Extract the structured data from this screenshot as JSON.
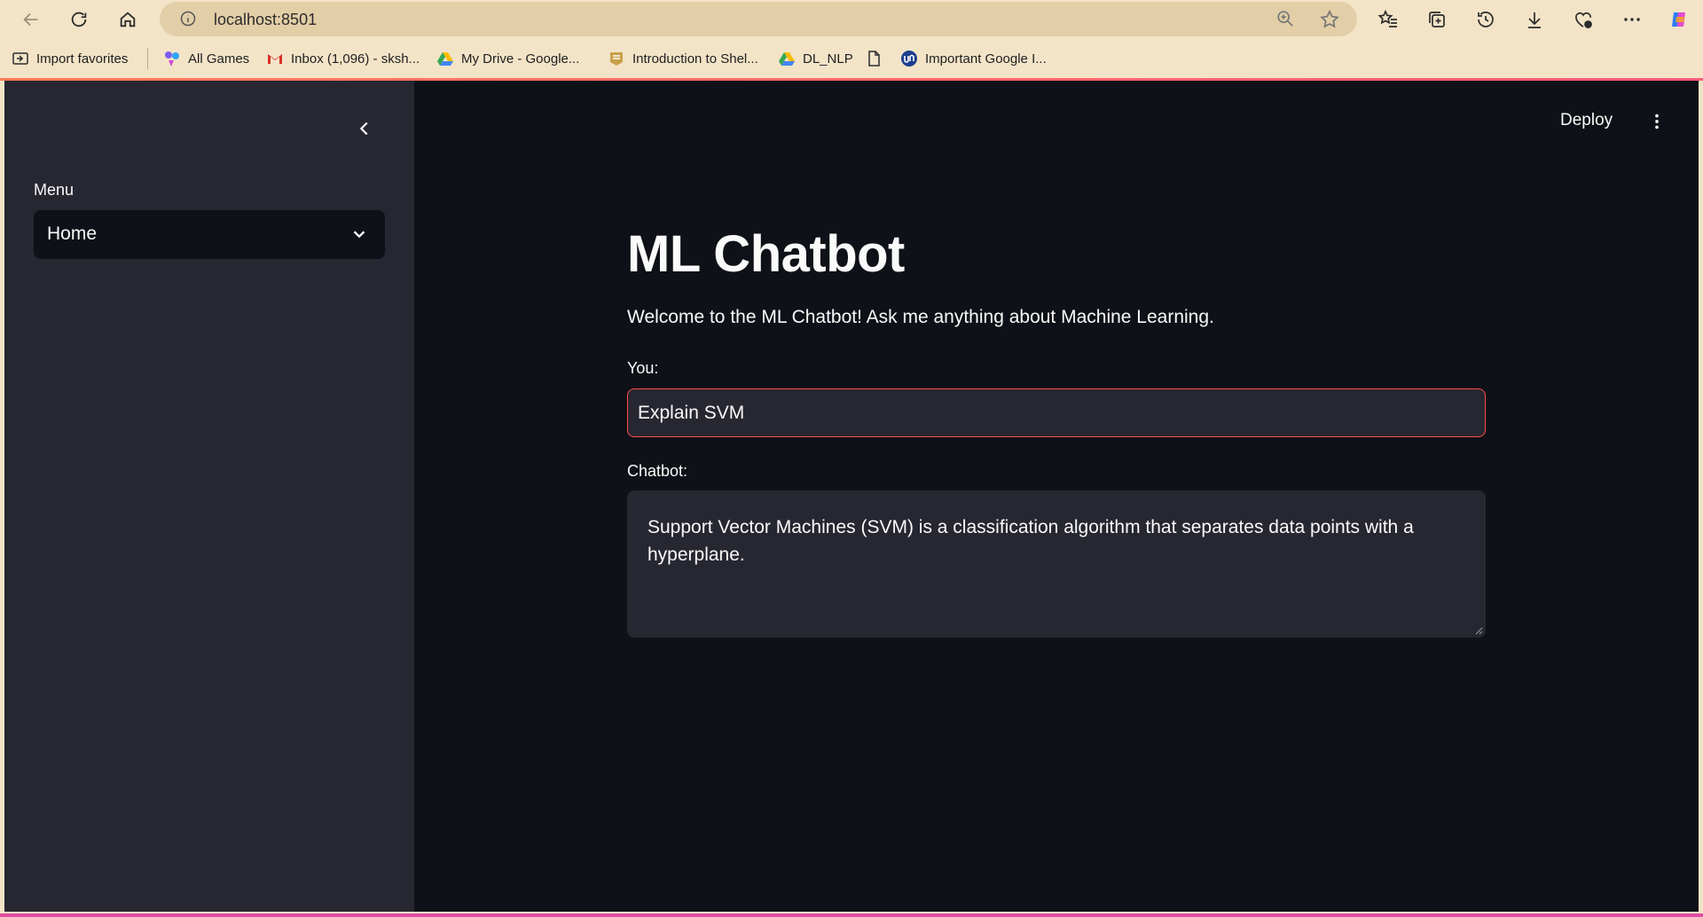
{
  "browser": {
    "url": "localhost:8501",
    "bookmarks": [
      {
        "label": "Import favorites"
      },
      {
        "label": "All Games"
      },
      {
        "label": "Inbox (1,096) - sksh..."
      },
      {
        "label": "My Drive - Google..."
      },
      {
        "label": "Introduction to Shel..."
      },
      {
        "label": "DL_NLP"
      },
      {
        "label": ""
      },
      {
        "label": "Important Google I..."
      }
    ]
  },
  "sidebar": {
    "menu_label": "Menu",
    "selected": "Home"
  },
  "header": {
    "deploy_label": "Deploy"
  },
  "main": {
    "title": "ML Chatbot",
    "welcome": "Welcome to the ML Chatbot! Ask me anything about Machine Learning.",
    "you_label": "You:",
    "you_value": "Explain SVM",
    "chatbot_label": "Chatbot:",
    "chatbot_response": "Support Vector Machines (SVM) is a classification algorithm that separates data points with a hyperplane."
  },
  "colors": {
    "app_bg": "#0e1117",
    "sidebar_bg": "#262730",
    "accent": "#ff4b4b",
    "browser_bg": "#f3e4c8"
  }
}
